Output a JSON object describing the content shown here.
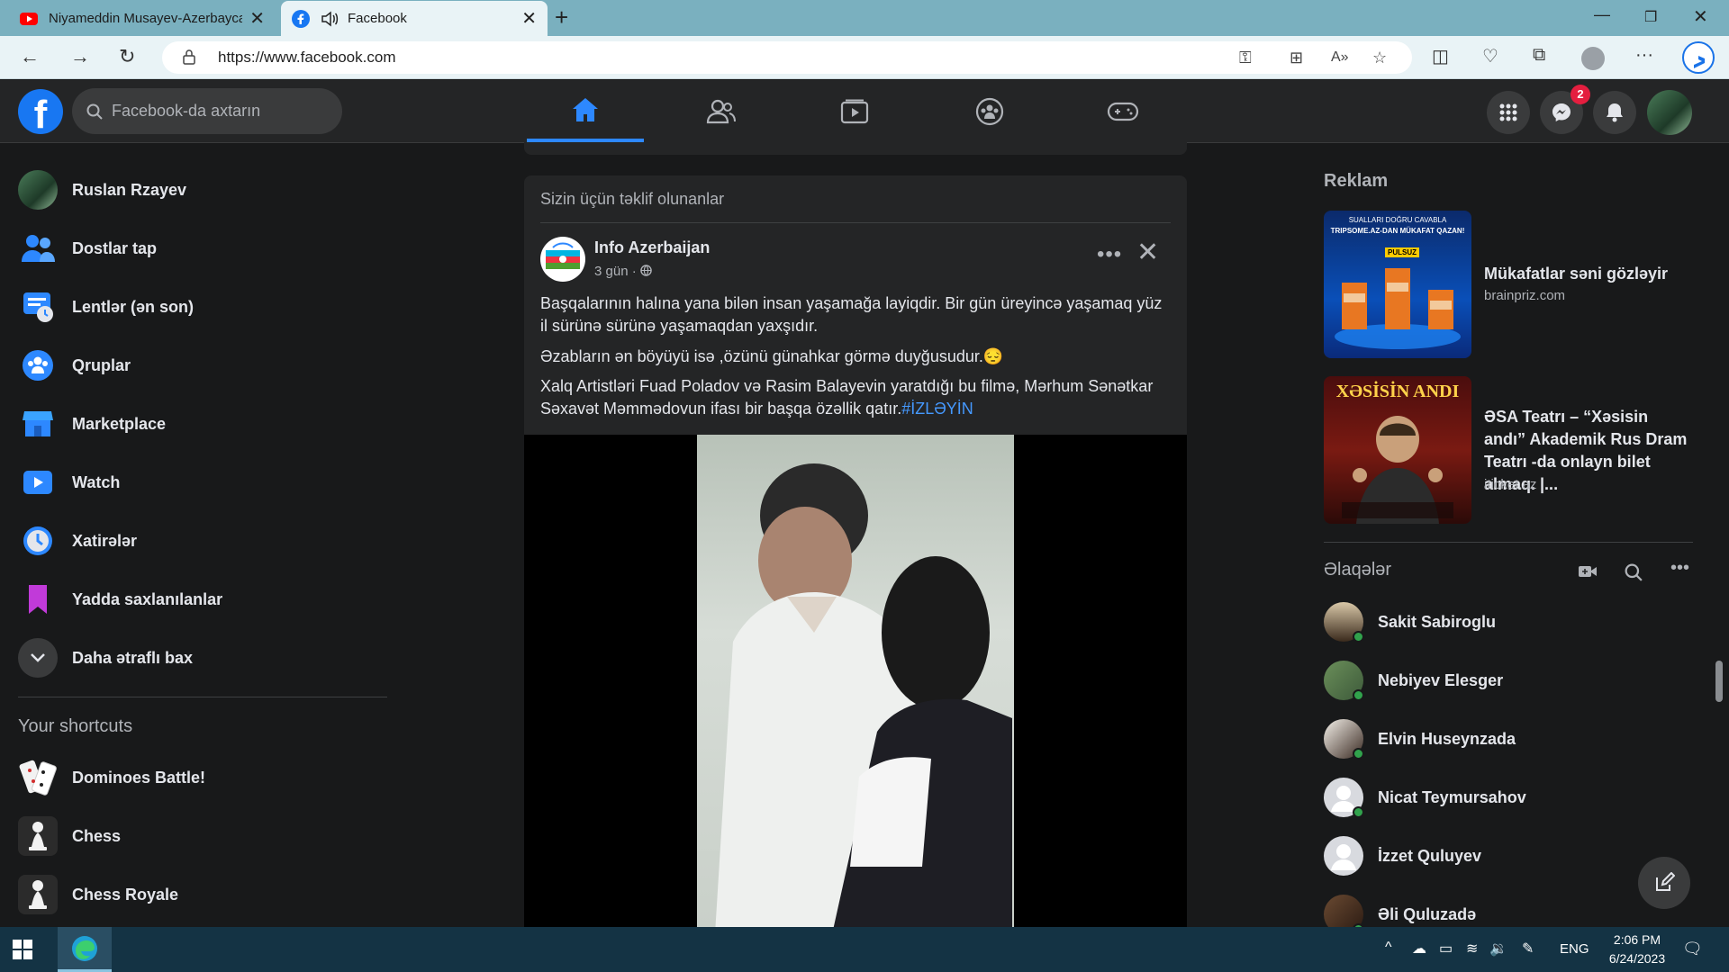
{
  "browser": {
    "tabs": [
      {
        "title": "Niyameddin Musayev-Azerbaycan",
        "icon": "youtube-icon"
      },
      {
        "title": "Facebook",
        "icon": "facebook-icon",
        "active": true
      }
    ],
    "url": "https://www.facebook.com"
  },
  "fb": {
    "search_placeholder": "Facebook-da axtarın",
    "messenger_badge": "2",
    "left_menu": [
      {
        "label": "Ruslan Rzayev",
        "icon": "profile-avatar"
      },
      {
        "label": "Dostlar tap",
        "icon": "friends-icon"
      },
      {
        "label": "Lentlər (ən son)",
        "icon": "feeds-icon"
      },
      {
        "label": "Qruplar",
        "icon": "groups-icon"
      },
      {
        "label": "Marketplace",
        "icon": "marketplace-icon"
      },
      {
        "label": "Watch",
        "icon": "watch-icon"
      },
      {
        "label": "Xatirələr",
        "icon": "memories-icon"
      },
      {
        "label": "Yadda saxlanılanlar",
        "icon": "saved-icon"
      },
      {
        "label": "Daha ətraflı bax",
        "icon": "chevron-down-icon"
      }
    ],
    "shortcuts_title": "Your shortcuts",
    "shortcuts": [
      {
        "label": "Dominoes Battle!"
      },
      {
        "label": "Chess"
      },
      {
        "label": "Chess Royale"
      }
    ],
    "post": {
      "suggested_label": "Sizin üçün təklif olunanlar",
      "author": "Info Azerbaijan",
      "time": "3 gün ·",
      "paragraphs": [
        "Başqalarının halına yana bilən insan yaşamağa layiqdir. Bir gün üreyincə yaşamaq yüz il sürünə sürünə yaşamaqdan yaxşıdır.",
        "Əzabların ən böyüyü isə ,özünü günahkar görmə duyğusudur.😔",
        "Xalq Artistləri Fuad Poladov və Rasim Balayevin yaratdığı bu filmə, Mərhum Sənətkar Səxavət Məmmədovun ifası bir başqa özəllik qatır."
      ],
      "hashtag": "#İZLƏYİN"
    },
    "ads": {
      "title": "Reklam",
      "items": [
        {
          "title": "Mükafatlar səni gözləyir",
          "source": "brainpriz.com",
          "image_text_top": "SUALLARI DOĞRU CAVABLA",
          "image_text_main": "TRIPSOME.AZ-DAN MÜKAFAT QAZAN!",
          "image_badge": "PULSUZ"
        },
        {
          "title": "ƏSA Teatrı – “Xəsisin andı” Akademik Rus Dram Teatrı -da onlayn bilet almaq. |...",
          "source": "iticket.az",
          "image_text_main": "XƏSİSİN ANDI"
        }
      ]
    },
    "contacts": {
      "title": "Əlaqələr",
      "items": [
        {
          "name": "Sakit Sabiroglu",
          "online": true
        },
        {
          "name": "Nebiyev Elesger",
          "online": true
        },
        {
          "name": "Elvin Huseynzada",
          "online": true
        },
        {
          "name": "Nicat Teymursahov",
          "online": true
        },
        {
          "name": "İzzet Quluyev",
          "online": false
        },
        {
          "name": "Əli Quluzadə",
          "online": true
        }
      ]
    }
  },
  "taskbar": {
    "language": "ENG",
    "time": "2:06 PM",
    "date": "6/24/2023"
  }
}
